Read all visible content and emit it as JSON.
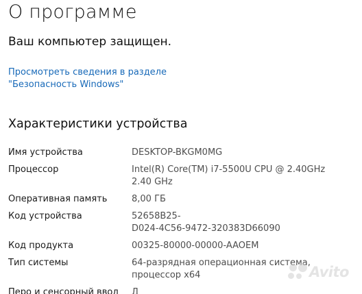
{
  "page": {
    "title": "О программе",
    "protected_text": "Ваш компьютер защищен.",
    "security_link": "Просмотреть сведения в разделе \"Безопасность Windows\""
  },
  "device_specs": {
    "heading": "Характеристики устройства",
    "rows": [
      {
        "label": "Имя устройства",
        "value": "DESKTOP-BKGM0MG"
      },
      {
        "label": "Процессор",
        "value": "Intel(R) Core(TM) i7-5500U CPU @ 2.40GHz\n2.40 GHz"
      },
      {
        "label": "Оперативная память",
        "value": "8,00 ГБ"
      },
      {
        "label": "Код устройства",
        "value": "52658B25-\nD024-4C56-9472-320383D66090"
      },
      {
        "label": "Код продукта",
        "value": "00325-80000-00000-AAOEM"
      },
      {
        "label": "Тип системы",
        "value": "64-разрядная операционная система,\nпроцессор x64"
      },
      {
        "label": "Перо и сенсорный ввод",
        "value": "Д"
      }
    ]
  },
  "watermark": {
    "text": "Avito"
  }
}
